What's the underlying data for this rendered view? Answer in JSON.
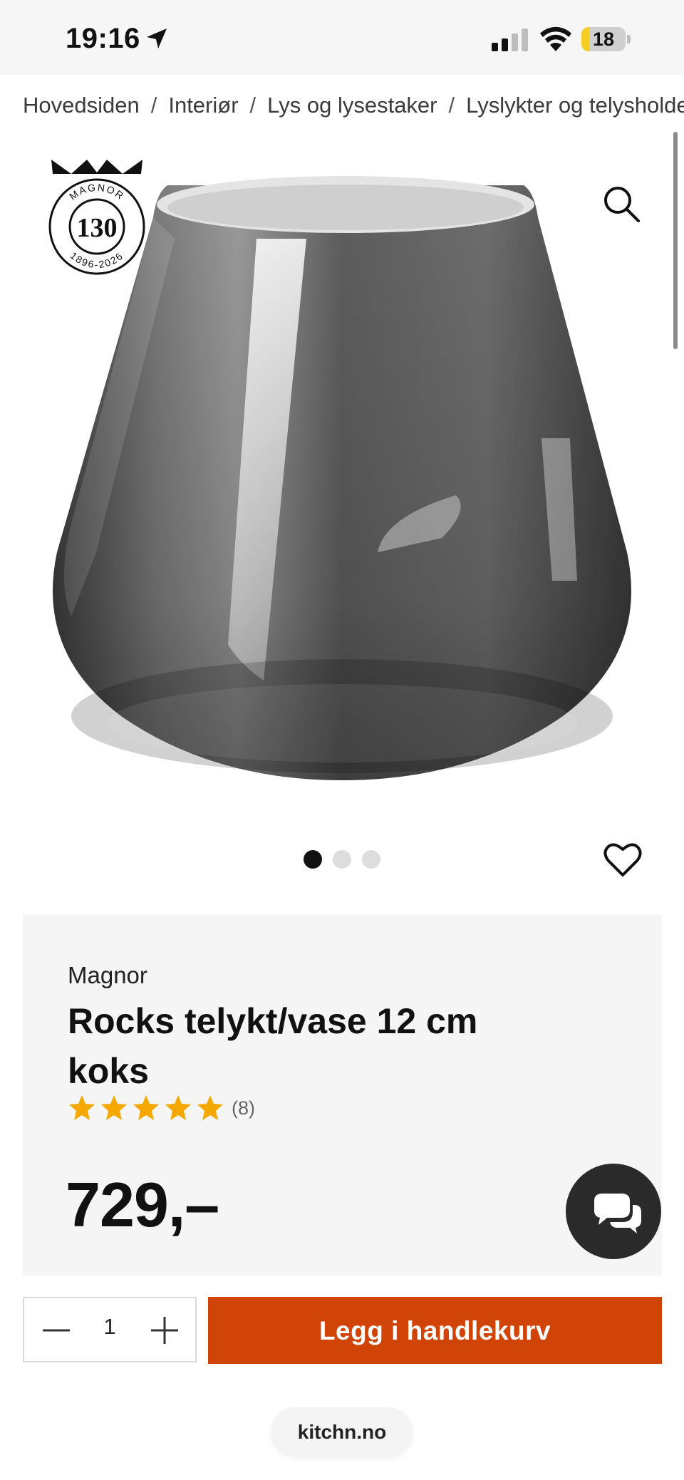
{
  "status_bar": {
    "time": "19:16",
    "battery_level": "18",
    "battery_fraction": 0.18,
    "icons": [
      "location-arrow-icon",
      "cellular-signal-icon",
      "wifi-icon",
      "battery-icon"
    ]
  },
  "breadcrumb": [
    "Hovedsiden",
    "Interiør",
    "Lys og lysestaker",
    "Lyslykter og telysholdere"
  ],
  "breadcrumb_separator": "/",
  "logo_badge": {
    "brand": "MAGNOR",
    "number": "130",
    "years": "1896-2026"
  },
  "gallery": {
    "image_count": 3,
    "active_index": 0
  },
  "product": {
    "brand": "Magnor",
    "title": "Rocks telykt/vase 12 cm koks",
    "rating": 5,
    "review_count": "(8)",
    "price": "729,–"
  },
  "quantity": {
    "value": "1",
    "minus_icon": "minus-icon",
    "plus_icon": "plus-icon"
  },
  "cart_button_label": "Legg i handlekurv",
  "domain": "kitchn.no",
  "colors": {
    "accent": "#d04407",
    "star": "#f5a800",
    "chat_button": "#2a2a2a",
    "card_bg": "#f5f5f5",
    "dot_active": "#111111",
    "dot_inactive": "#dddddd"
  }
}
